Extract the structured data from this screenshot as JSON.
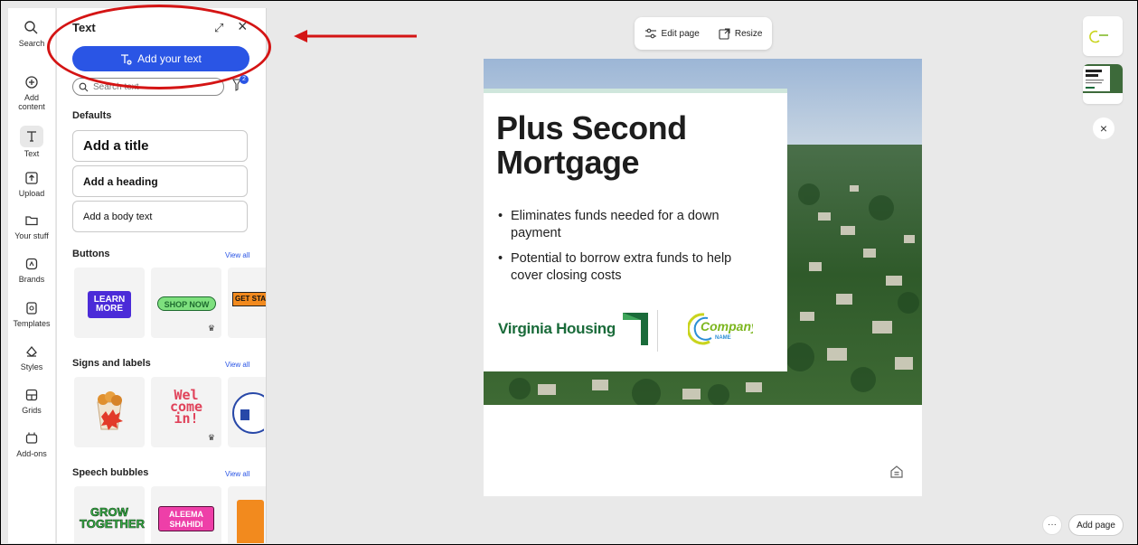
{
  "rail": {
    "items": [
      {
        "label": "Search",
        "icon": "search-icon"
      },
      {
        "label": "Add content",
        "icon": "plus-circle-icon"
      },
      {
        "label": "Text",
        "icon": "text-icon",
        "active": true
      },
      {
        "label": "Upload",
        "icon": "upload-icon"
      },
      {
        "label": "Your stuff",
        "icon": "folder-icon"
      },
      {
        "label": "Brands",
        "icon": "brand-icon"
      },
      {
        "label": "Templates",
        "icon": "templates-icon"
      },
      {
        "label": "Styles",
        "icon": "styles-icon"
      },
      {
        "label": "Grids",
        "icon": "grid-icon"
      },
      {
        "label": "Add-ons",
        "icon": "addons-icon"
      }
    ]
  },
  "panel": {
    "title": "Text",
    "add_text_label": "Add your text",
    "search_placeholder": "Search text",
    "filter_count": "2",
    "defaults_label": "Defaults",
    "defaults": {
      "title": "Add a title",
      "heading": "Add a heading",
      "body": "Add a body text"
    },
    "sections": {
      "buttons": {
        "label": "Buttons",
        "view_all": "View all",
        "tiles": [
          "LEARN MORE",
          "SHOP NOW",
          "GET STAR"
        ]
      },
      "signs": {
        "label": "Signs and labels",
        "view_all": "View all",
        "tiles": [
          "Wel come in!"
        ]
      },
      "speech": {
        "label": "Speech bubbles",
        "view_all": "View all",
        "tiles": [
          "GROW TOGETHER",
          "ALEEMA SHAHIDI"
        ]
      }
    }
  },
  "toolbar": {
    "edit_page": "Edit page",
    "resize": "Resize"
  },
  "page": {
    "headline_line1": "Plus Second",
    "headline_line2": "Mortgage",
    "bullets": [
      "Eliminates funds needed for a down payment",
      "Potential to borrow extra funds to help cover closing costs"
    ],
    "logo_text": "Virginia Housing",
    "company_logo": "Company",
    "company_logo_sub": "NAME"
  },
  "footer": {
    "add_page": "Add page",
    "more": "···"
  },
  "colors": {
    "accent": "#2a55e5",
    "annotation": "#d41414",
    "brand_green": "#1a6b3a"
  }
}
